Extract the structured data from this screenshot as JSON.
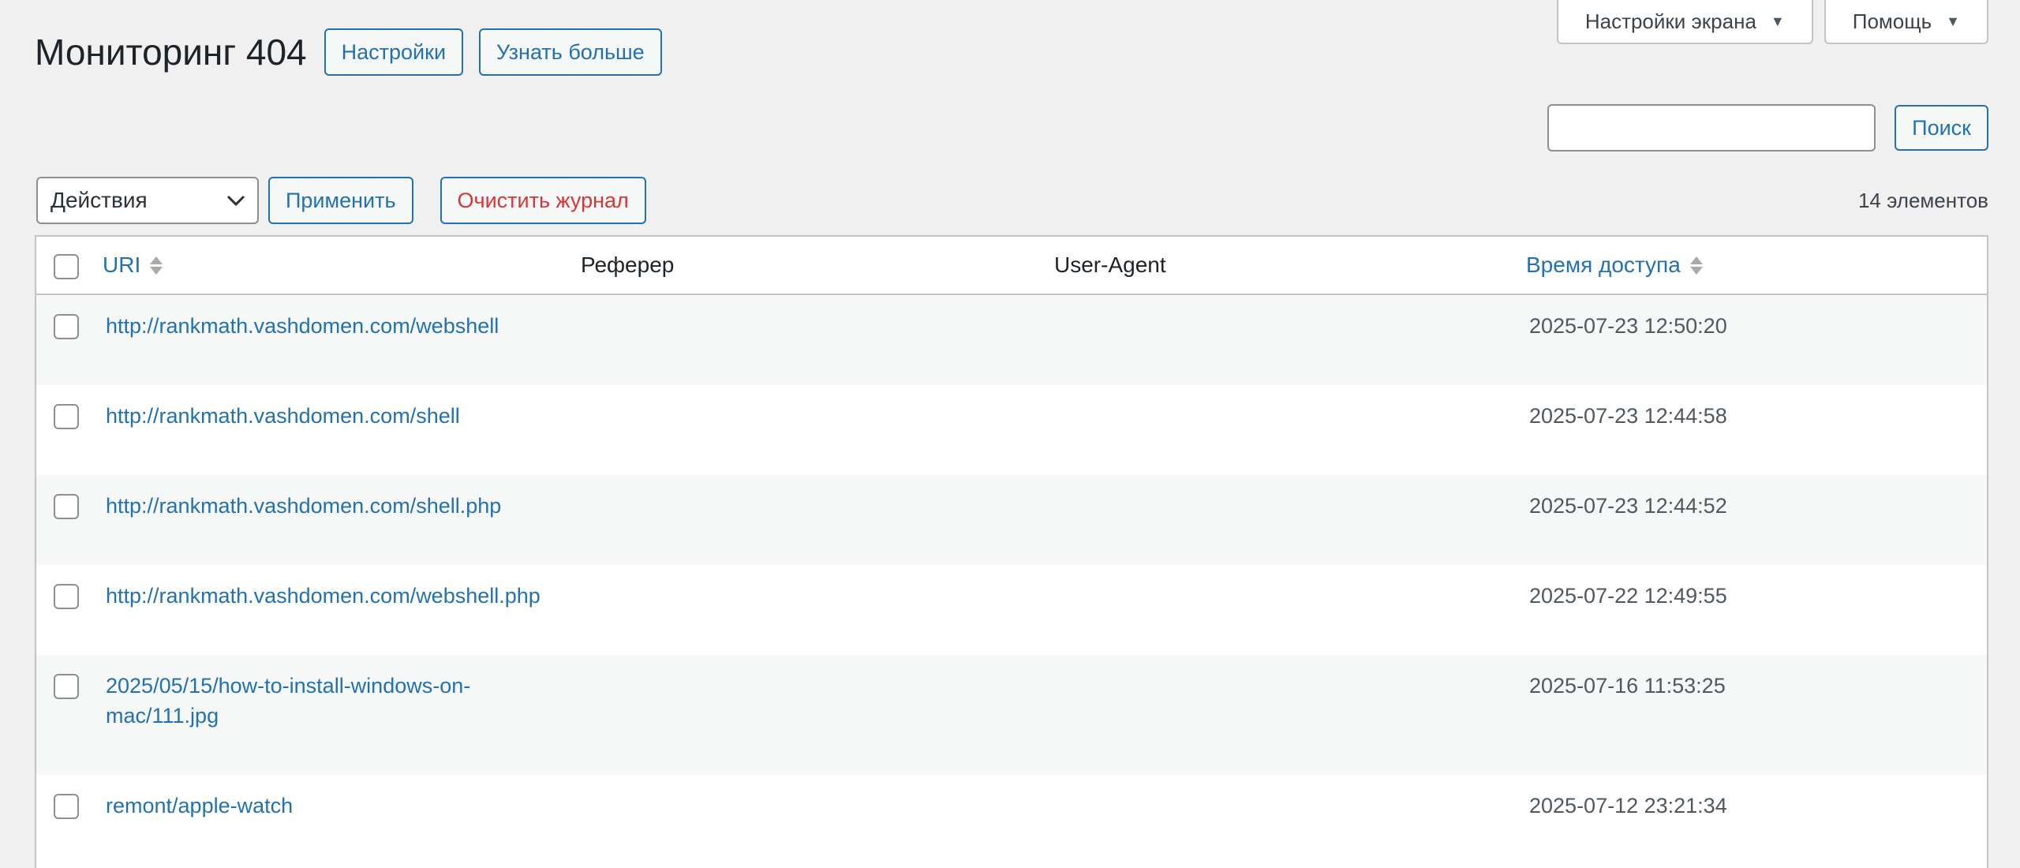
{
  "screen_meta": {
    "screen_options": "Настройки экрана",
    "help": "Помощь"
  },
  "page": {
    "title": "Мониторинг 404",
    "settings_button": "Настройки",
    "learn_more_button": "Узнать больше"
  },
  "search": {
    "value": "",
    "button": "Поиск"
  },
  "tablenav": {
    "bulk_actions": "Действия",
    "apply": "Применить",
    "clear_log": "Очистить журнал",
    "items_count": "14 элементов"
  },
  "table": {
    "columns": {
      "uri": "URI",
      "referer": "Реферер",
      "user_agent": "User-Agent",
      "access_time": "Время доступа"
    },
    "rows": [
      {
        "uri": "http://rankmath.vashdomen.com/webshell",
        "referer": "",
        "user_agent": "",
        "time": "2025-07-23 12:50:20"
      },
      {
        "uri": "http://rankmath.vashdomen.com/shell",
        "referer": "",
        "user_agent": "",
        "time": "2025-07-23 12:44:58"
      },
      {
        "uri": "http://rankmath.vashdomen.com/shell.php",
        "referer": "",
        "user_agent": "",
        "time": "2025-07-23 12:44:52"
      },
      {
        "uri": "http://rankmath.vashdomen.com/webshell.php",
        "referer": "",
        "user_agent": "",
        "time": "2025-07-22 12:49:55"
      },
      {
        "uri": "2025/05/15/how-to-install-windows-on-mac/111.jpg",
        "referer": "",
        "user_agent": "",
        "time": "2025-07-16 11:53:25"
      },
      {
        "uri": "remont/apple-watch",
        "referer": "",
        "user_agent": "",
        "time": "2025-07-12 23:21:34"
      }
    ]
  },
  "colors": {
    "accent": "#2271b1",
    "danger": "#d63638",
    "background": "#f0f0f1",
    "row_alt": "#f6f7f7"
  }
}
